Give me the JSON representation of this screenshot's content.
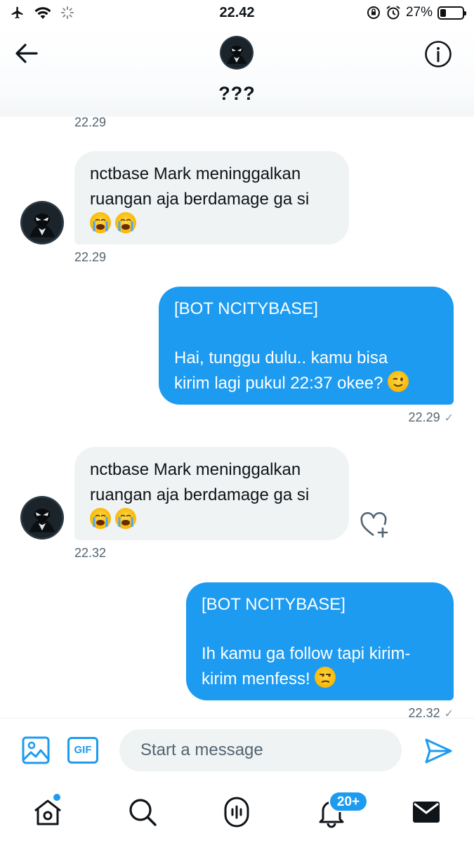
{
  "status_bar": {
    "time": "22.42",
    "battery": "27%",
    "battery_level": 0.27,
    "icons": [
      "airplane-icon",
      "wifi-icon",
      "loading-icon",
      "orientation-lock-icon",
      "alarm-icon",
      "battery-icon"
    ]
  },
  "header": {
    "title": "???",
    "avatar": "venom-avatar",
    "back_icon": "arrow-left-icon",
    "info_icon": "info-icon"
  },
  "messages": [
    {
      "type": "timestamp",
      "time": "22.29"
    },
    {
      "type": "incoming",
      "text": "nctbase Mark meninggalkan\nruangan aja berdamage ga si",
      "emojis": [
        "loudly-crying-face",
        "loudly-crying-face"
      ],
      "time": "22.29"
    },
    {
      "type": "outgoing",
      "header": "[BOT NCITYBASE]",
      "text": "Hai, tunggu dulu.. kamu bisa\nkirim lagi pukul 22:37 okee?",
      "emoji": "winking-face",
      "time": "22.29",
      "status": "✓"
    },
    {
      "type": "incoming",
      "text": "nctbase Mark meninggalkan\nruangan aja berdamage ga si",
      "emojis": [
        "loudly-crying-face",
        "loudly-crying-face"
      ],
      "time": "22.32",
      "reaction_icon": "heart-plus-icon"
    },
    {
      "type": "outgoing",
      "header": "[BOT NCITYBASE]",
      "text": "Ih kamu ga follow tapi kirim-\nkirim menfess!",
      "emoji": "unamused-face",
      "time": "22.32",
      "status": "✓"
    }
  ],
  "composer": {
    "placeholder": "Start a message",
    "gif_label": "GIF",
    "media_icon": "image-icon",
    "send_icon": "send-icon"
  },
  "bottom_nav": {
    "items": [
      "home-icon",
      "search-icon",
      "spaces-icon",
      "notifications-icon",
      "messages-icon"
    ],
    "notification_badge": "20+"
  },
  "colors": {
    "accent": "#1d9bf0",
    "incoming_bubble": "#eff3f4",
    "timestamp": "#536471"
  }
}
